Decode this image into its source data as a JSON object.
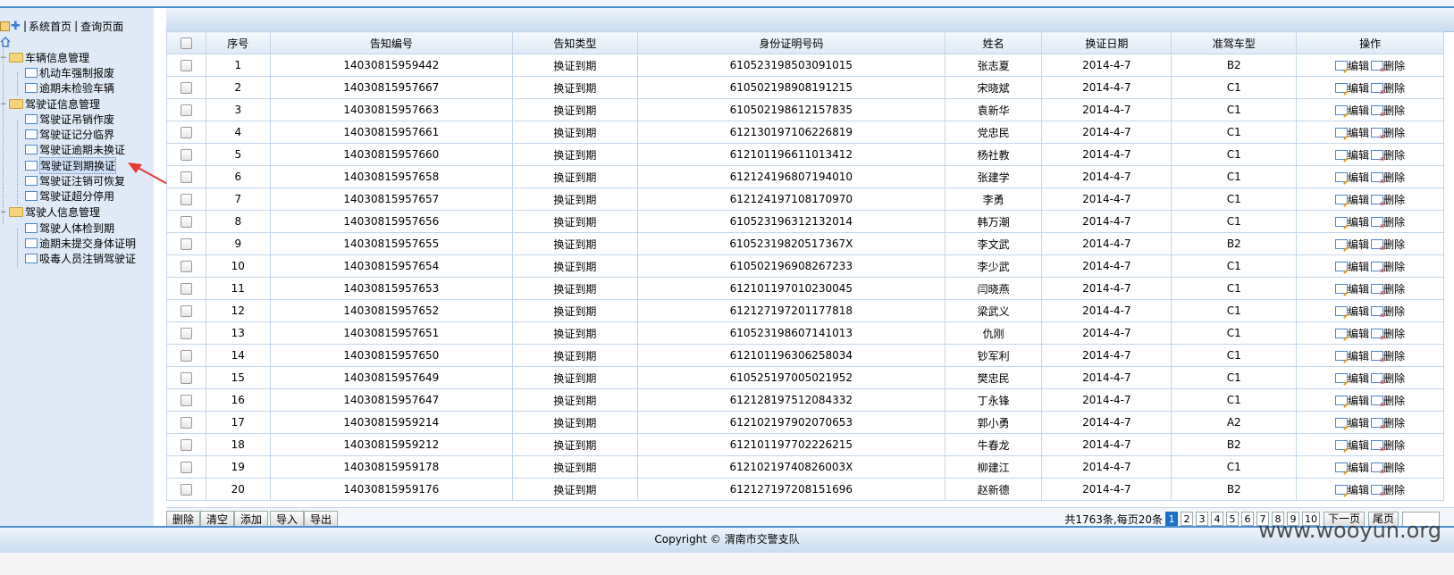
{
  "sidebar": {
    "top_links": [
      "系统首页",
      "查询页面"
    ],
    "separator": "|",
    "groups": [
      {
        "label": "车辆信息管理",
        "items": [
          "机动车强制报废",
          "逾期未检验车辆"
        ]
      },
      {
        "label": "驾驶证信息管理",
        "items": [
          "驾驶证吊销作废",
          "驾驶证记分临界",
          "驾驶证逾期未换证",
          "驾驶证到期换证",
          "驾驶证注销可恢复",
          "驾驶证超分停用"
        ]
      },
      {
        "label": "驾驶人信息管理",
        "items": [
          "驾驶人体检到期",
          "逾期未提交身体证明",
          "吸毒人员注销驾驶证"
        ]
      }
    ],
    "selected_item": "驾驶证到期换证"
  },
  "table": {
    "headers": [
      "序号",
      "告知编号",
      "告知类型",
      "身份证明号码",
      "姓名",
      "换证日期",
      "准驾车型",
      "操作"
    ],
    "edit_label": "编辑",
    "delete_label": "删除",
    "rows": [
      [
        "1",
        "14030815959442",
        "换证到期",
        "610523198503091015",
        "张志夏",
        "2014-4-7",
        "B2"
      ],
      [
        "2",
        "14030815957667",
        "换证到期",
        "610502198908191215",
        "宋晓斌",
        "2014-4-7",
        "C1"
      ],
      [
        "3",
        "14030815957663",
        "换证到期",
        "610502198612157835",
        "袁新华",
        "2014-4-7",
        "C1"
      ],
      [
        "4",
        "14030815957661",
        "换证到期",
        "612130197106226819",
        "党忠民",
        "2014-4-7",
        "C1"
      ],
      [
        "5",
        "14030815957660",
        "换证到期",
        "612101196611013412",
        "杨社教",
        "2014-4-7",
        "C1"
      ],
      [
        "6",
        "14030815957658",
        "换证到期",
        "612124196807194010",
        "张建学",
        "2014-4-7",
        "C1"
      ],
      [
        "7",
        "14030815957657",
        "换证到期",
        "612124197108170970",
        "李勇",
        "2014-4-7",
        "C1"
      ],
      [
        "8",
        "14030815957656",
        "换证到期",
        "610523196312132014",
        "韩万潮",
        "2014-4-7",
        "C1"
      ],
      [
        "9",
        "14030815957655",
        "换证到期",
        "61052319820517367X",
        "李文武",
        "2014-4-7",
        "B2"
      ],
      [
        "10",
        "14030815957654",
        "换证到期",
        "610502196908267233",
        "李少武",
        "2014-4-7",
        "C1"
      ],
      [
        "11",
        "14030815957653",
        "换证到期",
        "612101197010230045",
        "闫晓燕",
        "2014-4-7",
        "C1"
      ],
      [
        "12",
        "14030815957652",
        "换证到期",
        "612127197201177818",
        "梁武义",
        "2014-4-7",
        "C1"
      ],
      [
        "13",
        "14030815957651",
        "换证到期",
        "610523198607141013",
        "仇刚",
        "2014-4-7",
        "C1"
      ],
      [
        "14",
        "14030815957650",
        "换证到期",
        "612101196306258034",
        "钞军利",
        "2014-4-7",
        "C1"
      ],
      [
        "15",
        "14030815957649",
        "换证到期",
        "610525197005021952",
        "樊忠民",
        "2014-4-7",
        "C1"
      ],
      [
        "16",
        "14030815957647",
        "换证到期",
        "612128197512084332",
        "丁永锋",
        "2014-4-7",
        "C1"
      ],
      [
        "17",
        "14030815959214",
        "换证到期",
        "612102197902070653",
        "郭小勇",
        "2014-4-7",
        "A2"
      ],
      [
        "18",
        "14030815959212",
        "换证到期",
        "612101197702226215",
        "牛春龙",
        "2014-4-7",
        "B2"
      ],
      [
        "19",
        "14030815959178",
        "换证到期",
        "61210219740826003X",
        "柳建江",
        "2014-4-7",
        "C1"
      ],
      [
        "20",
        "14030815959176",
        "换证到期",
        "612127197208151696",
        "赵新德",
        "2014-4-7",
        "B2"
      ]
    ]
  },
  "toolbar": {
    "buttons": [
      "删除",
      "清空",
      "添加",
      "导入",
      "导出"
    ]
  },
  "pager": {
    "summary": "共1763条,每页20条",
    "pages": [
      "1",
      "2",
      "3",
      "4",
      "5",
      "6",
      "7",
      "8",
      "9",
      "10"
    ],
    "current": "1",
    "next": "下一页",
    "last": "尾页",
    "jump_value": ""
  },
  "footer": {
    "copyright": "Copyright © 渭南市交警支队"
  },
  "watermark": "www.wooyun.org",
  "colors": {
    "accent": "#4f8fd0",
    "sidebar_bg": "#dfeaf6",
    "current_page": "#1e6fc8",
    "arrow": "#e53935"
  }
}
